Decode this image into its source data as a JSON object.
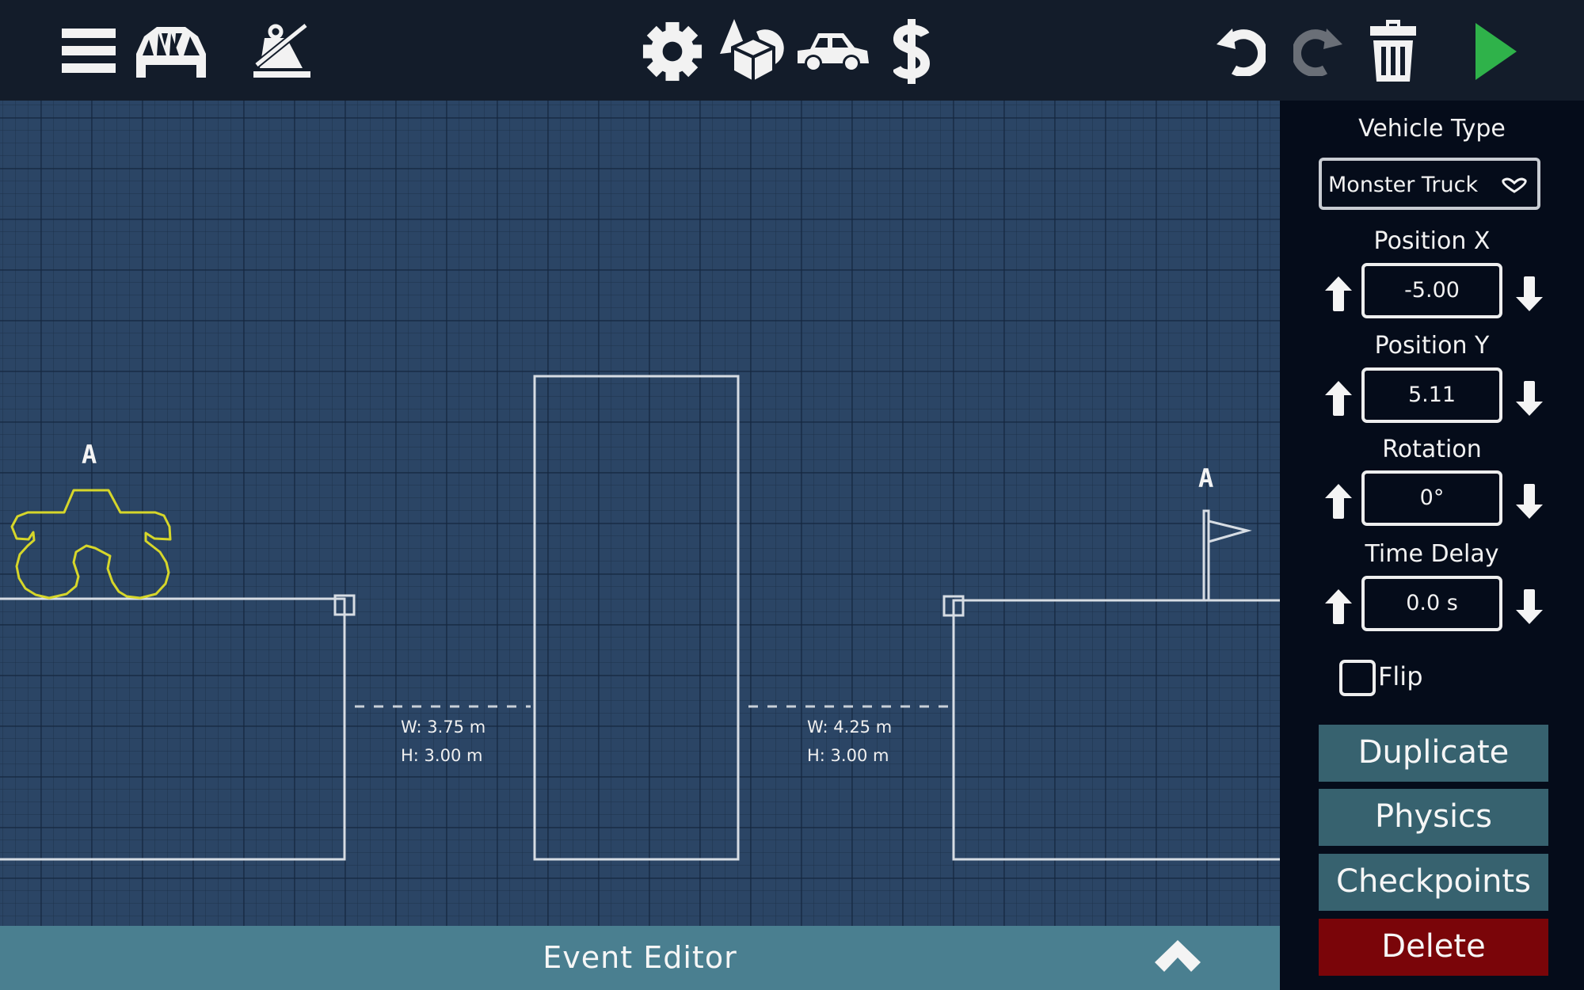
{
  "toolbar": {
    "left": [
      {
        "name": "menu-button",
        "icon": "hamburger-menu-icon"
      },
      {
        "name": "bridge-button",
        "icon": "bridge-icon"
      },
      {
        "name": "weight-toggle-button",
        "icon": "weight-off-icon"
      }
    ],
    "center": [
      {
        "name": "settings-button",
        "icon": "gear-icon"
      },
      {
        "name": "shapes-button",
        "icon": "shapes-icon"
      },
      {
        "name": "vehicles-button",
        "icon": "car-icon"
      },
      {
        "name": "budget-button",
        "icon": "dollar-icon"
      }
    ],
    "right": [
      {
        "name": "undo-button",
        "icon": "undo-icon",
        "enabled": true
      },
      {
        "name": "redo-button",
        "icon": "redo-icon",
        "enabled": false
      },
      {
        "name": "delete-all-button",
        "icon": "trash-icon"
      },
      {
        "name": "play-button",
        "icon": "play-icon"
      }
    ],
    "colors": {
      "icon": "#f2f2f2",
      "disabled_icon": "#6a6f77",
      "play": "#2fb24a"
    }
  },
  "canvas": {
    "vehicle_marker_label": "A",
    "flag_marker_label": "A",
    "vehicle_color": "#d6d62a",
    "gaps": [
      {
        "width_label": "W: 3.75 m",
        "height_label": "H: 3.00 m"
      },
      {
        "width_label": "W: 4.25 m",
        "height_label": "H: 3.00 m"
      }
    ]
  },
  "event_editor": {
    "label": "Event Editor",
    "toggle_icon": "chevron-up-icon"
  },
  "panel": {
    "vehicle_type": {
      "label": "Vehicle Type",
      "value": "Monster Truck"
    },
    "position_x": {
      "label": "Position X",
      "value": "-5.00"
    },
    "position_y": {
      "label": "Position Y",
      "value": "5.11"
    },
    "rotation": {
      "label": "Rotation",
      "value": "0°"
    },
    "time_delay": {
      "label": "Time Delay",
      "value": "0.0 s"
    },
    "flip": {
      "label": "Flip",
      "checked": false
    },
    "buttons": {
      "duplicate": "Duplicate",
      "physics": "Physics",
      "checkpoints": "Checkpoints",
      "delete": "Delete"
    },
    "colors": {
      "button": "#37626f",
      "delete": "#7a0509"
    }
  }
}
